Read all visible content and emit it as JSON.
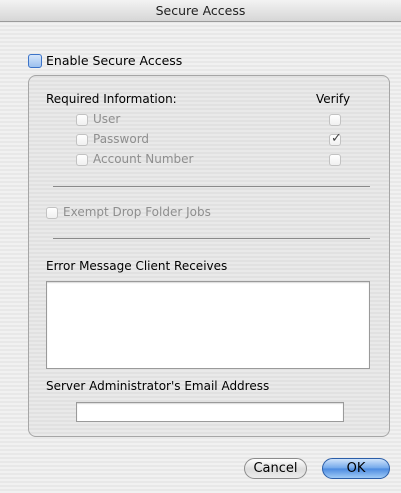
{
  "window": {
    "title": "Secure Access"
  },
  "enable_secure_access": {
    "label": "Enable Secure Access",
    "checked": false
  },
  "required_info": {
    "heading": "Required Information:",
    "verify_heading": "Verify",
    "items": [
      {
        "label": "User",
        "checked": false,
        "verify_checked": false
      },
      {
        "label": "Password",
        "checked": false,
        "verify_checked": true
      },
      {
        "label": "Account Number",
        "checked": false,
        "verify_checked": false
      }
    ]
  },
  "exempt_drop_folder": {
    "label": "Exempt Drop Folder Jobs",
    "checked": false
  },
  "error_message": {
    "label": "Error Message Client Receives",
    "value": ""
  },
  "admin_email": {
    "label": "Server Administrator's Email Address",
    "value": ""
  },
  "buttons": {
    "cancel": "Cancel",
    "ok": "OK"
  }
}
